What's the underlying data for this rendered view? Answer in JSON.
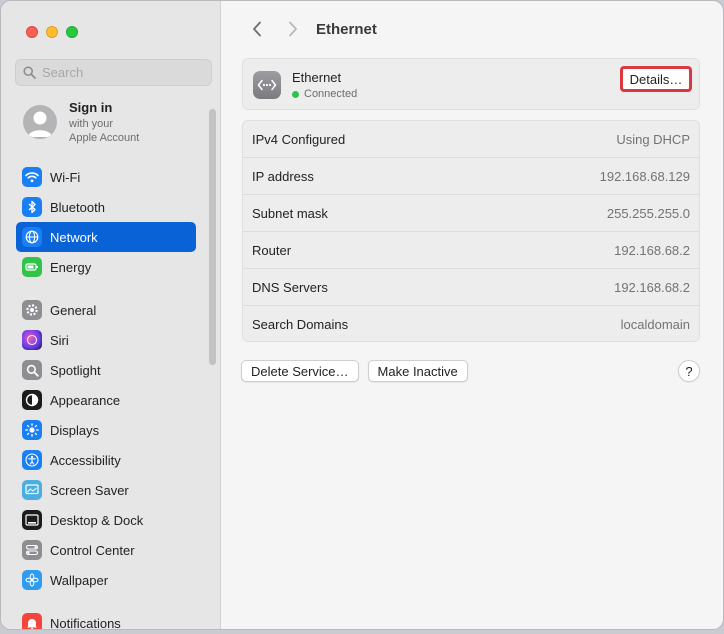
{
  "window": {
    "title": "Ethernet"
  },
  "search": {
    "placeholder": "Search"
  },
  "account": {
    "name": "Sign in",
    "line1": "with your",
    "line2": "Apple Account"
  },
  "sidebar": {
    "group1": [
      {
        "label": "Wi-Fi",
        "icon": "wifi-icon",
        "color": "#1a7ff5"
      },
      {
        "label": "Bluetooth",
        "icon": "bluetooth-icon",
        "color": "#1a7ff5"
      },
      {
        "label": "Network",
        "icon": "globe-icon",
        "color": "#1a7ff5",
        "active": true
      },
      {
        "label": "Energy",
        "icon": "battery-icon",
        "color": "#33c24a"
      }
    ],
    "group2": [
      {
        "label": "General",
        "icon": "gear-icon",
        "color": "#8e8d92"
      },
      {
        "label": "Siri",
        "icon": "siri-icon",
        "color": "#3b3b6e"
      },
      {
        "label": "Spotlight",
        "icon": "magnifier-icon",
        "color": "#8e8d92"
      },
      {
        "label": "Appearance",
        "icon": "appearance-icon",
        "color": "#1c1c1e"
      },
      {
        "label": "Displays",
        "icon": "sun-icon",
        "color": "#1a7ff5"
      },
      {
        "label": "Accessibility",
        "icon": "accessibility-icon",
        "color": "#1a7ff5"
      },
      {
        "label": "Screen Saver",
        "icon": "screensaver-icon",
        "color": "#4aaee0"
      },
      {
        "label": "Desktop & Dock",
        "icon": "dock-icon",
        "color": "#1c1c1e"
      },
      {
        "label": "Control Center",
        "icon": "control-center-icon",
        "color": "#8e8d92"
      },
      {
        "label": "Wallpaper",
        "icon": "flower-icon",
        "color": "#2f9cf0"
      }
    ],
    "group3": [
      {
        "label": "Notifications",
        "icon": "bell-icon",
        "color": "#f2453d"
      }
    ]
  },
  "service": {
    "name": "Ethernet",
    "status": "Connected",
    "details_label": "Details…"
  },
  "info_rows": [
    {
      "label": "IPv4 Configured",
      "value": "Using DHCP"
    },
    {
      "label": "IP address",
      "value": "192.168.68.129"
    },
    {
      "label": "Subnet mask",
      "value": "255.255.255.0"
    },
    {
      "label": "Router",
      "value": "192.168.68.2"
    },
    {
      "label": "DNS Servers",
      "value": "192.168.68.2"
    },
    {
      "label": "Search Domains",
      "value": "localdomain"
    }
  ],
  "actions": {
    "delete_label": "Delete Service…",
    "inactive_label": "Make Inactive",
    "help_label": "?"
  }
}
